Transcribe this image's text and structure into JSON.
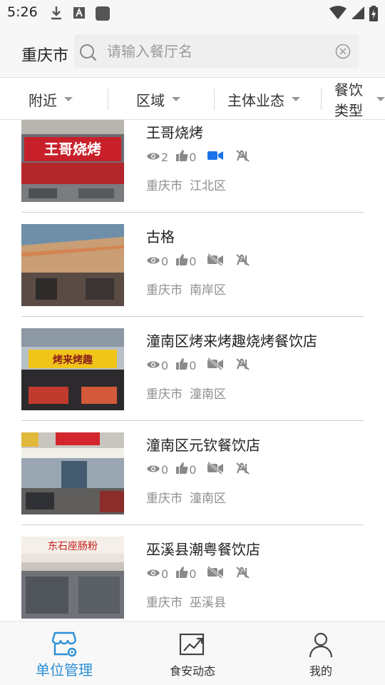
{
  "status_bar": {
    "time": "5:26",
    "icons": [
      "download-icon",
      "text-a-icon",
      "app-square-icon",
      "wifi-icon",
      "signal-icon",
      "battery-charging-icon"
    ]
  },
  "header": {
    "city": "重庆市",
    "search": {
      "placeholder": "请输入餐厅名",
      "value": ""
    }
  },
  "filters": [
    {
      "label": "附近"
    },
    {
      "label": "区域"
    },
    {
      "label": "主体业态"
    },
    {
      "label": "餐饮类型"
    }
  ],
  "restaurants": [
    {
      "name": "王哥烧烤",
      "views": "2",
      "likes": "0",
      "video": true,
      "city": "重庆市",
      "district": "江北区",
      "sign_text": "王哥烧烤",
      "sign_color": "#d9262b"
    },
    {
      "name": "古格",
      "views": "0",
      "likes": "0",
      "video": false,
      "city": "重庆市",
      "district": "南岸区"
    },
    {
      "name": "潼南区烤来烤趣烧烤餐饮店",
      "views": "0",
      "likes": "0",
      "video": false,
      "city": "重庆市",
      "district": "潼南区",
      "sign_text": "烤来烤趣",
      "sign_color": "#f0c419"
    },
    {
      "name": "潼南区元钦餐饮店",
      "views": "0",
      "likes": "0",
      "video": false,
      "city": "重庆市",
      "district": "潼南区"
    },
    {
      "name": "巫溪县潮粤餐饮店",
      "views": "0",
      "likes": "0",
      "video": false,
      "city": "重庆市",
      "district": "巫溪县",
      "sign_text": "东石座肠粉"
    }
  ],
  "bottom_nav": [
    {
      "label": "单位管理",
      "icon": "store-gear-icon",
      "active": true
    },
    {
      "label": "食安动态",
      "icon": "trend-chart-icon",
      "active": false
    },
    {
      "label": "我的",
      "icon": "user-icon",
      "active": false
    }
  ],
  "colors": {
    "accent": "#2b8fd6",
    "video_active": "#1a73e8",
    "icon_gray": "#8a8a8a",
    "divider": "#cfcfcf"
  }
}
